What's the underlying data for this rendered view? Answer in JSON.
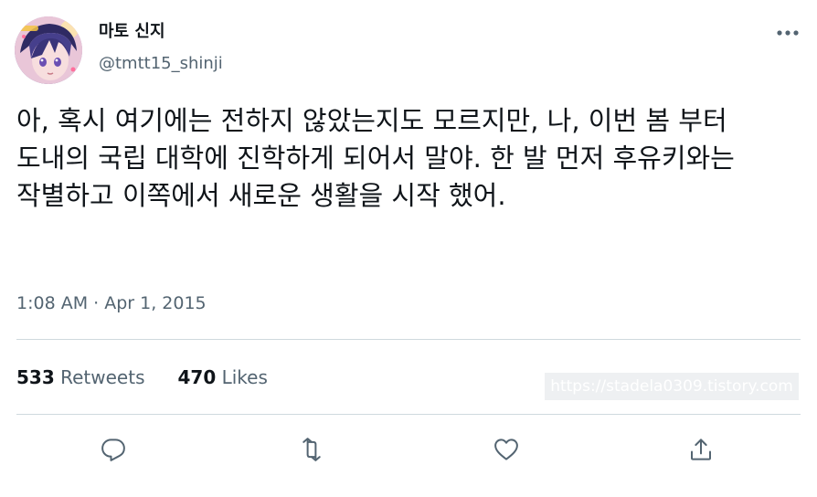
{
  "author": {
    "display_name": "마토 신지",
    "handle": "@tmtt15_shinji",
    "avatar_icon": "anime-character-avatar"
  },
  "more_icon": "ellipsis-icon",
  "tweet": {
    "text": "아, 혹시 여기에는 전하지 않았는지도 모르지만, 나, 이번 봄 부터 도내의 국립 대학에 진학하게 되어서 말야. 한 발 먼저 후유키와는 작별하고 이쪽에서 새로운 생활을 시작 했어.",
    "timestamp": "1:08 AM · Apr 1, 2015"
  },
  "stats": {
    "retweets_count": "533",
    "retweets_label": "Retweets",
    "likes_count": "470",
    "likes_label": "Likes"
  },
  "watermark": "https://stadela0309.tistory.com",
  "actions": {
    "reply_icon": "reply-icon",
    "retweet_icon": "retweet-icon",
    "like_icon": "heart-icon",
    "share_icon": "share-icon"
  },
  "colors": {
    "text_primary": "#0f1419",
    "text_secondary": "#536471",
    "divider": "#cfd9de",
    "icon": "#536471"
  }
}
